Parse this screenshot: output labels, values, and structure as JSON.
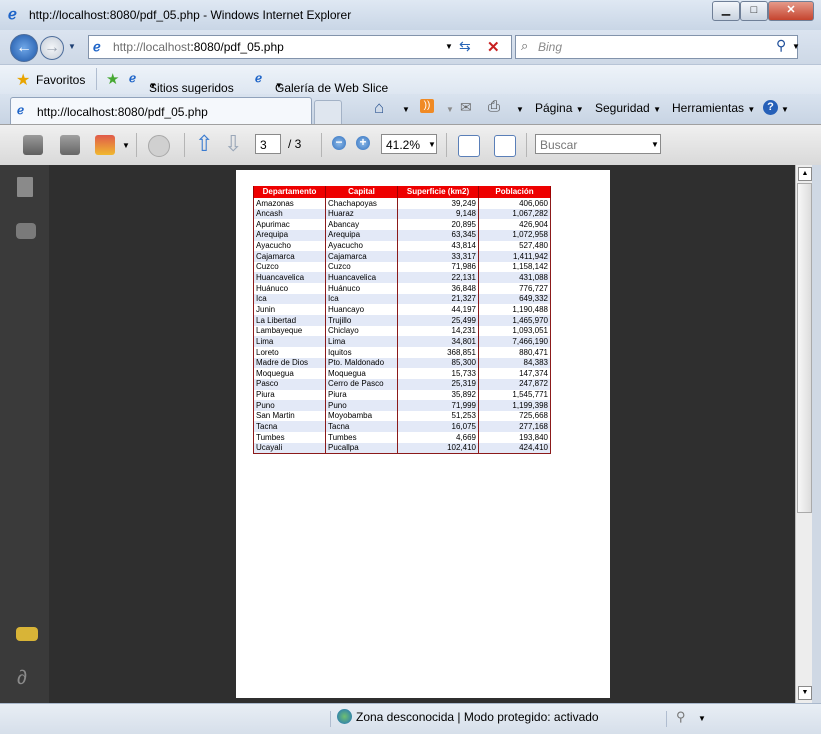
{
  "window": {
    "title": "http://localhost:8080/pdf_05.php - Windows Internet Explorer",
    "minimize_glyph": "▁",
    "maximize_glyph": "□",
    "close_glyph": "✕"
  },
  "address_bar": {
    "url_prefix": "http://localhost",
    "url_rest": ":8080/pdf_05.php",
    "search_placeholder": "Bing"
  },
  "favorites_bar": {
    "favorites_label": "Favoritos",
    "suggested_sites": "Sitios sugeridos",
    "web_slice_gallery": "Galería de Web Slice"
  },
  "tab": {
    "title": "http://localhost:8080/pdf_05.php"
  },
  "command_bar": {
    "page": "Página",
    "security": "Seguridad",
    "tools": "Herramientas",
    "help_glyph": "?"
  },
  "pdf_toolbar": {
    "current_page": "3",
    "page_total": "/ 3",
    "zoom": "41.2%",
    "search_placeholder": "Buscar"
  },
  "pdf_table": {
    "headers": [
      "Departamento",
      "Capital",
      "Superficie (km2)",
      "Población"
    ],
    "rows": [
      [
        "Amazonas",
        "Chachapoyas",
        "39,249",
        "406,060"
      ],
      [
        "Ancash",
        "Huaraz",
        "9,148",
        "1,067,282"
      ],
      [
        "Apurimac",
        "Abancay",
        "20,895",
        "426,904"
      ],
      [
        "Arequipa",
        "Arequipa",
        "63,345",
        "1,072,958"
      ],
      [
        "Ayacucho",
        "Ayacucho",
        "43,814",
        "527,480"
      ],
      [
        "Cajamarca",
        "Cajamarca",
        "33,317",
        "1,411,942"
      ],
      [
        "Cuzco",
        "Cuzco",
        "71,986",
        "1,158,142"
      ],
      [
        "Huancavelica",
        "Huancavelica",
        "22,131",
        "431,088"
      ],
      [
        "Huánuco",
        "Huánuco",
        "36,848",
        "776,727"
      ],
      [
        "Ica",
        "Ica",
        "21,327",
        "649,332"
      ],
      [
        "Junin",
        "Huancayo",
        "44,197",
        "1,190,488"
      ],
      [
        "La Libertad",
        "Trujillo",
        "25,499",
        "1,465,970"
      ],
      [
        "Lambayeque",
        "Chiclayo",
        "14,231",
        "1,093,051"
      ],
      [
        "Lima",
        "Lima",
        "34,801",
        "7,466,190"
      ],
      [
        "Loreto",
        "Iquitos",
        "368,851",
        "880,471"
      ],
      [
        "Madre de Dios",
        "Pto. Maldonado",
        "85,300",
        "84,383"
      ],
      [
        "Moquegua",
        "Moquegua",
        "15,733",
        "147,374"
      ],
      [
        "Pasco",
        "Cerro de Pasco",
        "25,319",
        "247,872"
      ],
      [
        "Piura",
        "Piura",
        "35,892",
        "1,545,771"
      ],
      [
        "Puno",
        "Puno",
        "71,999",
        "1,199,398"
      ],
      [
        "San Martin",
        "Moyobamba",
        "51,253",
        "725,668"
      ],
      [
        "Tacna",
        "Tacna",
        "16,075",
        "277,168"
      ],
      [
        "Tumbes",
        "Tumbes",
        "4,669",
        "193,840"
      ],
      [
        "Ucayali",
        "Pucallpa",
        "102,410",
        "424,410"
      ]
    ]
  },
  "status_bar": {
    "zone_text": "Zona desconocida | Modo protegido: activado"
  },
  "colors": {
    "table_header": "#ee0000",
    "table_alt_row": "#e3e9f7",
    "viewer_background": "#2f2f2f"
  }
}
